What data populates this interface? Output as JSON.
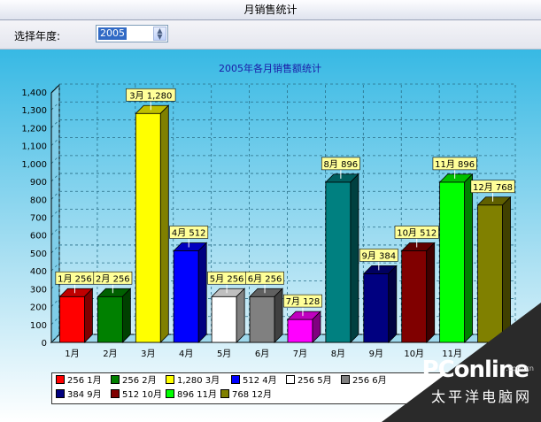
{
  "window": {
    "title": "月销售统计"
  },
  "toolbar": {
    "year_label": "选择年度:",
    "year_value": "2005"
  },
  "chart_data": {
    "type": "bar",
    "title": "2005年各月销售额统计",
    "categories": [
      "1月",
      "2月",
      "3月",
      "4月",
      "5月",
      "6月",
      "7月",
      "8月",
      "9月",
      "10月",
      "11月",
      "12月"
    ],
    "values": [
      256,
      256,
      1280,
      512,
      256,
      256,
      128,
      896,
      384,
      512,
      896,
      768
    ],
    "data_labels": [
      "1月 256",
      "2月 256",
      "3月 1,280",
      "4月 512",
      "5月 256",
      "6月 256",
      "7月 128",
      "8月 896",
      "9月 384",
      "10月 512",
      "11月 896",
      "12月 768"
    ],
    "colors": [
      "#ff0000",
      "#008000",
      "#ffff00",
      "#0000ff",
      "#ffffff",
      "#808080",
      "#ff00ff",
      "#008080",
      "#000080",
      "#800000",
      "#00ff00",
      "#808000"
    ],
    "ylim": [
      0,
      1400
    ],
    "yticks": [
      "0",
      "100",
      "200",
      "300",
      "400",
      "500",
      "600",
      "700",
      "800",
      "900",
      "1,000",
      "1,100",
      "1,200",
      "1,300",
      "1,400"
    ],
    "grid": true,
    "legend_position": "bottom",
    "legend": [
      "256 1月",
      "256 2月",
      "1,280 3月",
      "512 4月",
      "256 5月",
      "256 6月",
      "384 9月",
      "512 10月",
      "896 11月",
      "768 12月"
    ],
    "legend_colors": [
      "#ff0000",
      "#008000",
      "#ffff00",
      "#0000ff",
      "#ffffff",
      "#808080",
      "#000080",
      "#800000",
      "#00ff00",
      "#808000"
    ]
  },
  "watermark": {
    "logo": "PConline",
    "domain": ".com.cn",
    "cn": "太平洋电脑网"
  }
}
